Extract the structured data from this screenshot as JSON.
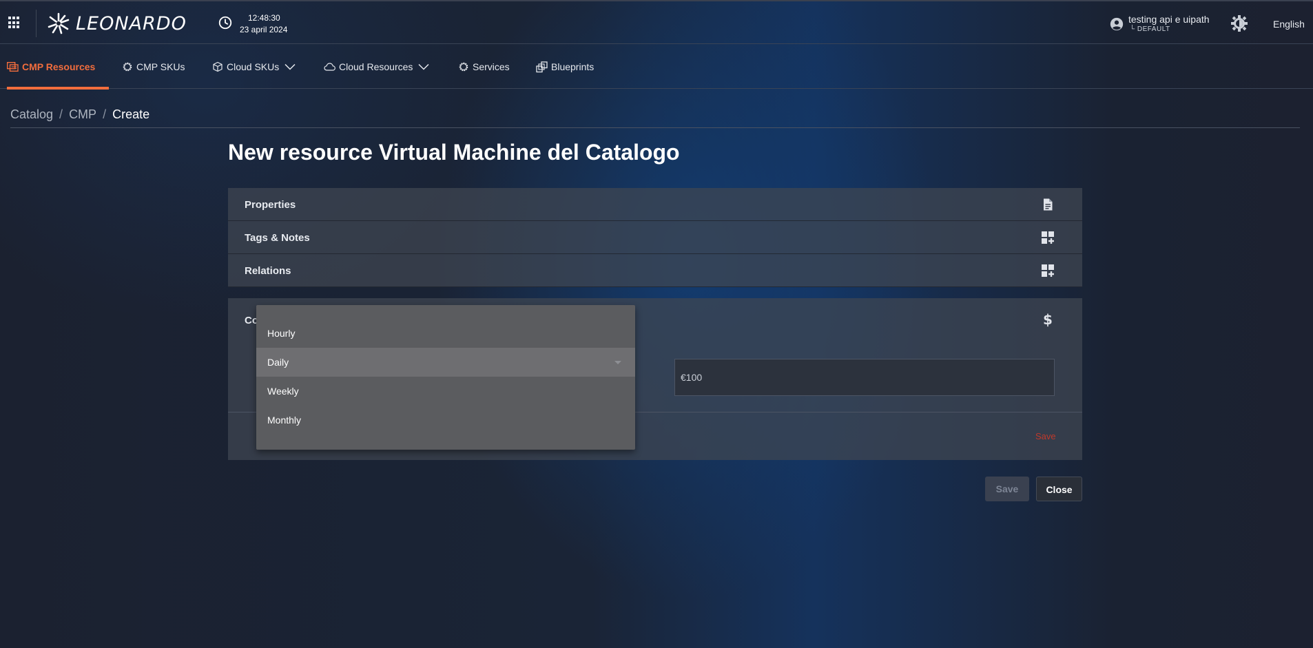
{
  "header": {
    "logo_text": "LEONARDO",
    "time": "12:48:30",
    "date": "23 april 2024",
    "user_name": "testing api e uipath",
    "user_tenant": "└ DEFAULT",
    "language": "English"
  },
  "nav": {
    "items": [
      {
        "label": "CMP Resources",
        "icon": "resources-icon",
        "active": true
      },
      {
        "label": "CMP SKUs",
        "icon": "gear-icon"
      },
      {
        "label": "Cloud SKUs",
        "icon": "cube-icon",
        "has_dropdown": true
      },
      {
        "label": "Cloud Resources",
        "icon": "cloud-icon",
        "has_dropdown": true
      },
      {
        "label": "Services",
        "icon": "gear-icon"
      },
      {
        "label": "Blueprints",
        "icon": "blueprint-icon"
      }
    ]
  },
  "breadcrumb": {
    "items": [
      "Catalog",
      "CMP",
      "Create"
    ],
    "separator": "/"
  },
  "page": {
    "title": "New resource Virtual Machine del Catalogo"
  },
  "sections": [
    {
      "label": "Properties",
      "icon": "document-icon"
    },
    {
      "label": "Tags & Notes",
      "icon": "dashboard-add-icon"
    },
    {
      "label": "Relations",
      "icon": "dashboard-add-icon"
    }
  ],
  "costs": {
    "label": "Costs",
    "icon": "dollar-icon",
    "amount_value": "€100",
    "save_label": "Save"
  },
  "dropdown": {
    "options": [
      "Hourly",
      "Daily",
      "Weekly",
      "Monthly"
    ],
    "selected": "Daily"
  },
  "actions": {
    "save_label": "Save",
    "close_label": "Close"
  },
  "colors": {
    "accent": "#f26d3d",
    "danger": "#c0392b"
  }
}
